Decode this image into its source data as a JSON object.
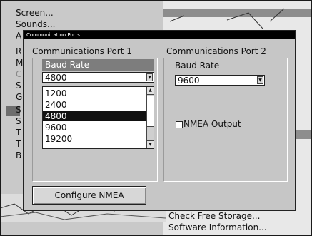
{
  "background_menu": {
    "items": [
      "Screen...",
      "Sounds...",
      "A",
      "R",
      "M",
      "C",
      "S",
      "G",
      "S",
      "S",
      "T",
      "T",
      "B"
    ],
    "bottom_items": [
      "Check Free Storage...",
      "Software Information..."
    ]
  },
  "dialog": {
    "title": "Communication Ports",
    "port1": {
      "title": "Communications Port 1",
      "header": "Baud Rate",
      "selected_value": "4800",
      "options": [
        "1200",
        "2400",
        "4800",
        "9600",
        "19200"
      ],
      "selected_option": "4800"
    },
    "port2": {
      "title": "Communications Port 2",
      "baud_label": "Baud Rate",
      "baud_value": "9600",
      "nmea_label": "NMEA Output",
      "nmea_checked": false
    },
    "configure_button": "Configure NMEA"
  }
}
